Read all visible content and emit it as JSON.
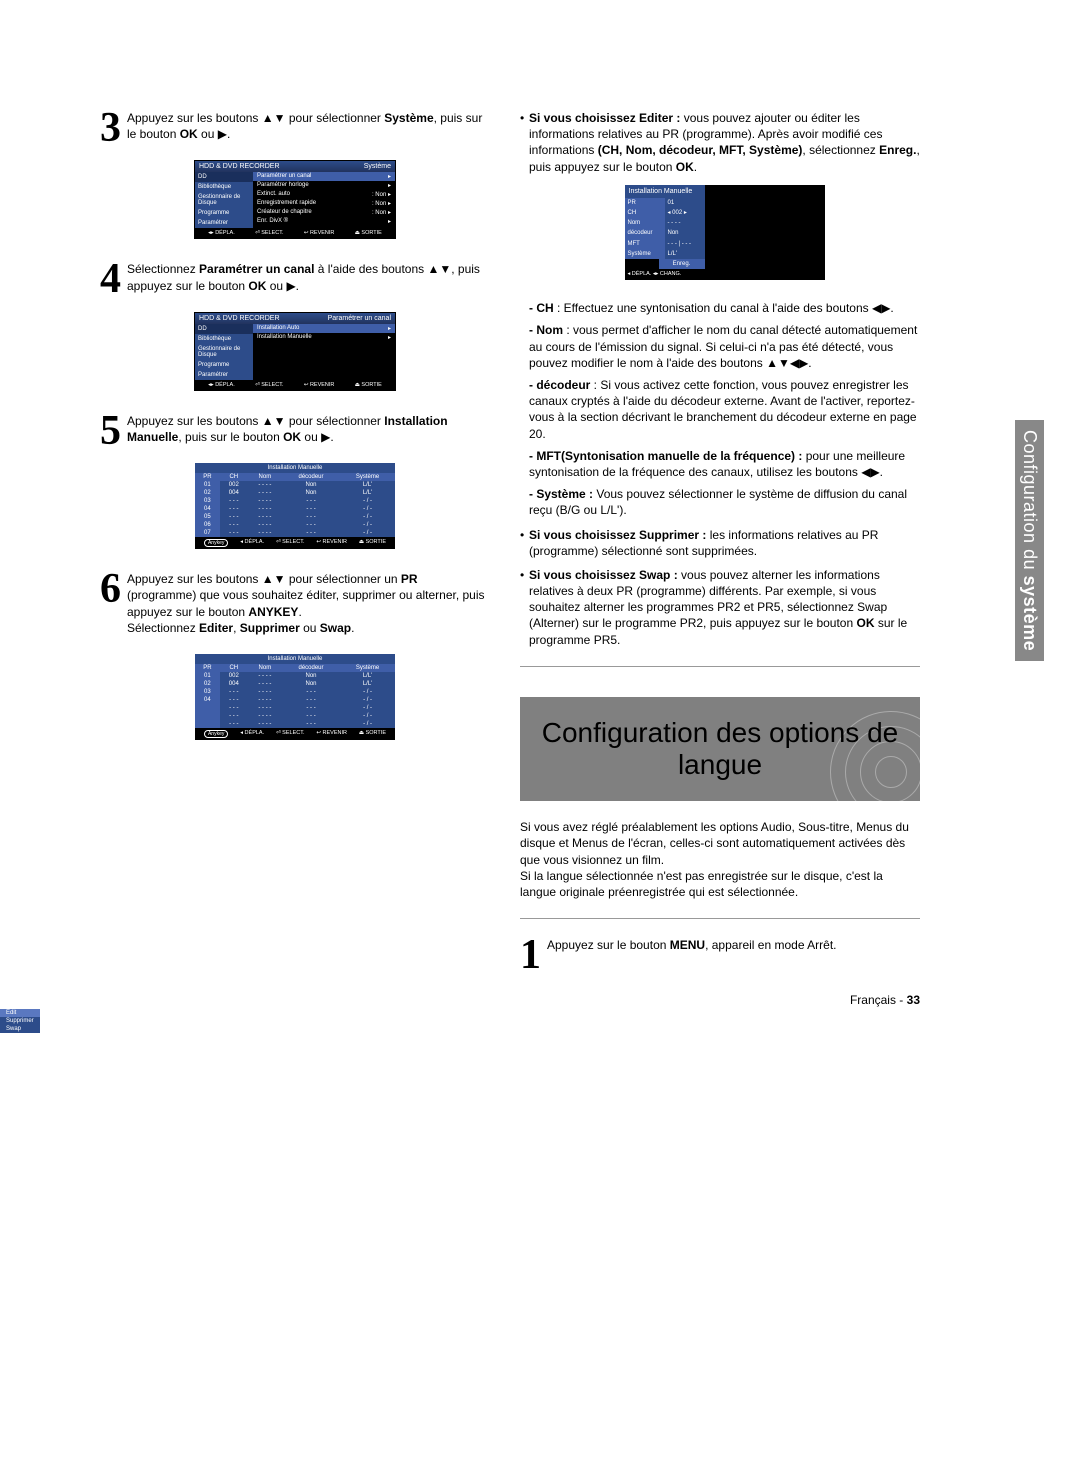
{
  "step3": {
    "text_prefix": "Appuyez sur les boutons ",
    "glyph1": "▲▼",
    "text_mid": " pour sélectionner ",
    "bold1": "Système",
    "text_after1": ", puis sur le bouton ",
    "bold2": "OK",
    "text_after2": " ou ",
    "glyph2": "▶",
    "text_end": "."
  },
  "osd1": {
    "title_left": "HDD & DVD RECORDER",
    "title_right": "Système",
    "dd": "DD",
    "side": [
      "Bibliothèque",
      "Gestionnaire de Disque",
      "Programme",
      "Paramétrer"
    ],
    "rows": [
      {
        "l": "Paramétrer un canal",
        "r": "▸",
        "hl": true
      },
      {
        "l": "Paramétrer horloge",
        "r": "▸"
      },
      {
        "l": "Extinct. auto",
        "r": ": Non   ▸"
      },
      {
        "l": "Enregistrement rapide",
        "r": ": Non   ▸"
      },
      {
        "l": "Créateur de chapitre",
        "r": ": Non   ▸"
      },
      {
        "l": "Enr. DivX ®",
        "r": "▸"
      }
    ],
    "foot": [
      "◂▸ DÉPLA.",
      "⏎ SELECT.",
      "↩ REVENIR",
      "⏏ SORTIE"
    ]
  },
  "step4": {
    "prefix": "Sélectionnez ",
    "bold1": "Paramétrer un canal",
    "mid1": " à l'aide des boutons ",
    "glyph1": "▲▼",
    "mid2": ", puis appuyez sur le bouton ",
    "bold2": "OK",
    "mid3": " ou ",
    "glyph2": "▶",
    "end": "."
  },
  "osd2": {
    "title_left": "HDD & DVD RECORDER",
    "title_right": "Paramétrer un canal",
    "dd": "DD",
    "side": [
      "Bibliothèque",
      "Gestionnaire de Disque",
      "Programme",
      "Paramétrer"
    ],
    "rows": [
      {
        "l": "Installation Auto",
        "r": "▸",
        "hl": true
      },
      {
        "l": "Installation Manuelle",
        "r": "▸"
      }
    ],
    "foot": [
      "◂▸ DÉPLA.",
      "⏎ SELECT.",
      "↩ REVENIR",
      "⏏ SORTIE"
    ]
  },
  "step5": {
    "prefix": "Appuyez sur les boutons ",
    "glyph1": "▲▼",
    "mid1": " pour sélectionner ",
    "bold1": "Installation Manuelle",
    "mid2": ", puis sur le bouton ",
    "bold2": "OK",
    "mid3": " ou ",
    "glyph2": "▶",
    "end": "."
  },
  "table1": {
    "title": "Installation Manuelle",
    "head": [
      "PR",
      "CH",
      "Nom",
      "décodeur",
      "Système"
    ],
    "rows": [
      [
        "01",
        "002",
        "- - - -",
        "Non",
        "L/L'"
      ],
      [
        "02",
        "004",
        "- - - -",
        "Non",
        "L/L'"
      ],
      [
        "03",
        "- - -",
        "- - - -",
        "- - -",
        "- / -"
      ],
      [
        "04",
        "- - -",
        "- - - -",
        "- - -",
        "- / -"
      ],
      [
        "05",
        "- - -",
        "- - - -",
        "- - -",
        "- / -"
      ],
      [
        "06",
        "- - -",
        "- - - -",
        "- - -",
        "- / -"
      ],
      [
        "07",
        "- - -",
        "- - - -",
        "- - -",
        "- / -"
      ]
    ],
    "anykey": "Anykey",
    "foot": [
      "◂ DÉPLA.",
      "⏎ SELECT.",
      "↩ REVENIR",
      "⏏ SORTIE"
    ]
  },
  "step6": {
    "prefix": "Appuyez sur les boutons ",
    "glyph1": "▲▼",
    "mid1": " pour sélectionner un ",
    "bold1": "PR",
    "mid2": " (programme) que vous souhaitez éditer, supprimer ou alterner, puis appuyez sur le bouton ",
    "bold2": "ANYKEY",
    "end": ".",
    "line2a": "Sélectionnez ",
    "line2b": "Editer",
    "line2c": ", ",
    "line2d": "Supprimer",
    "line2e": " ou ",
    "line2f": "Swap",
    "line2g": "."
  },
  "table2": {
    "title": "Installation Manuelle",
    "head": [
      "PR",
      "CH",
      "Nom",
      "décodeur",
      "Système"
    ],
    "rows": [
      [
        "01",
        "002",
        "- - - -",
        "Non",
        "L/L'"
      ],
      [
        "02",
        "004",
        "- - - -",
        "Non",
        "L/L'"
      ],
      [
        "03",
        "- - -",
        "- - - -",
        "- - -",
        "- / -"
      ],
      [
        "04",
        "- - -",
        "- - - -",
        "- - -",
        "- / -"
      ],
      [
        "",
        "- - -",
        "- - - -",
        "- - -",
        "- / -"
      ],
      [
        "",
        "- - -",
        "- - - -",
        "- - -",
        "- / -"
      ],
      [
        "",
        "- - -",
        "- - - -",
        "- - -",
        "- / -"
      ]
    ],
    "menu": [
      "Edit",
      "Supprimer",
      "Swap"
    ],
    "anykey": "Anykey",
    "foot": [
      "◂ DÉPLA.",
      "⏎ SELECT.",
      "↩ REVENIR",
      "⏏ SORTIE"
    ]
  },
  "editer": {
    "lead_bold": "Si vous choisissez Editer :",
    "lead_rest": " vous pouvez ajouter ou éditer les informations relatives au PR (programme). Après avoir modifié ces informations ",
    "bold2": "(CH, Nom, décodeur, MFT, Système)",
    "rest2": ", sélectionnez ",
    "bold3": "Enreg.",
    "rest3": ", puis appuyez sur le bouton ",
    "bold4": "OK",
    "end": "."
  },
  "miniosd": {
    "title": "Installation Manuelle",
    "rows": [
      {
        "l": "PR",
        "v": "01"
      },
      {
        "l": "CH",
        "v": "◂ 002 ▸"
      },
      {
        "l": "Nom",
        "v": "- - - -"
      },
      {
        "l": "décodeur",
        "v": "Non"
      },
      {
        "l": "MFT",
        "v": "- - - | - - -"
      },
      {
        "l": "Système",
        "v": "L/L'"
      }
    ],
    "btn": "Enreg.",
    "ft": "◂ DÉPLA.   ◂▸ CHANG."
  },
  "defs": {
    "ch_tag": "- CH",
    "ch": " : Effectuez une syntonisation du canal à l'aide des boutons ◀▶.",
    "nom_tag": "- Nom",
    "nom": " : vous permet d'afficher le nom du canal détecté automatiquement au cours de l'émission du signal. Si celui-ci n'a pas été détecté, vous pouvez modifier le nom à l'aide des boutons ▲▼◀▶.",
    "dec_tag": "- décodeur",
    "dec": " : Si vous activez cette fonction, vous pouvez enregistrer les canaux cryptés à l'aide du décodeur externe. Avant de l'activer, reportez-vous à la section décrivant le branchement du décodeur externe en page 20.",
    "mft_tag": "- MFT(Syntonisation manuelle de la fréquence) :",
    "mft": " pour une meilleure syntonisation de la fréquence des canaux, utilisez les boutons ◀▶.",
    "sys_tag": "- Système :",
    "sys": " Vous pouvez sélectionner le système de diffusion du canal reçu (B/G ou L/L')."
  },
  "supprimer": {
    "bold": "Si vous choisissez Supprimer :",
    "text": " les informations relatives au PR (programme) sélectionné sont supprimées."
  },
  "swap": {
    "bold": "Si vous choisissez Swap :",
    "text": " vous pouvez alterner les informations relatives à deux PR (programme) différents. Par exemple, si vous souhaitez alterner les programmes PR2 et PR5, sélectionnez Swap (Alterner) sur le programme PR2, puis appuyez sur le bouton ",
    "bold2": "OK",
    "text2": " sur le programme PR5."
  },
  "lang_heading": "Configuration des options de langue",
  "lang_intro": "Si vous avez réglé préalablement les options Audio, Sous-titre, Menus du disque et Menus de l'écran, celles-ci sont automatiquement activées dès que vous visionnez un film.\nSi la langue sélectionnée n'est pas enregistrée sur le disque, c'est la langue originale préenregistrée qui est sélectionnée.",
  "lang_step1": {
    "prefix": "Appuyez sur le bouton ",
    "bold": "MENU",
    "rest": ", appareil en mode Arrêt."
  },
  "side_tab_l1": "Configuration du",
  "side_tab_l2": "système",
  "footer_lang": "Français",
  "footer_sep": " - ",
  "footer_page": "33"
}
